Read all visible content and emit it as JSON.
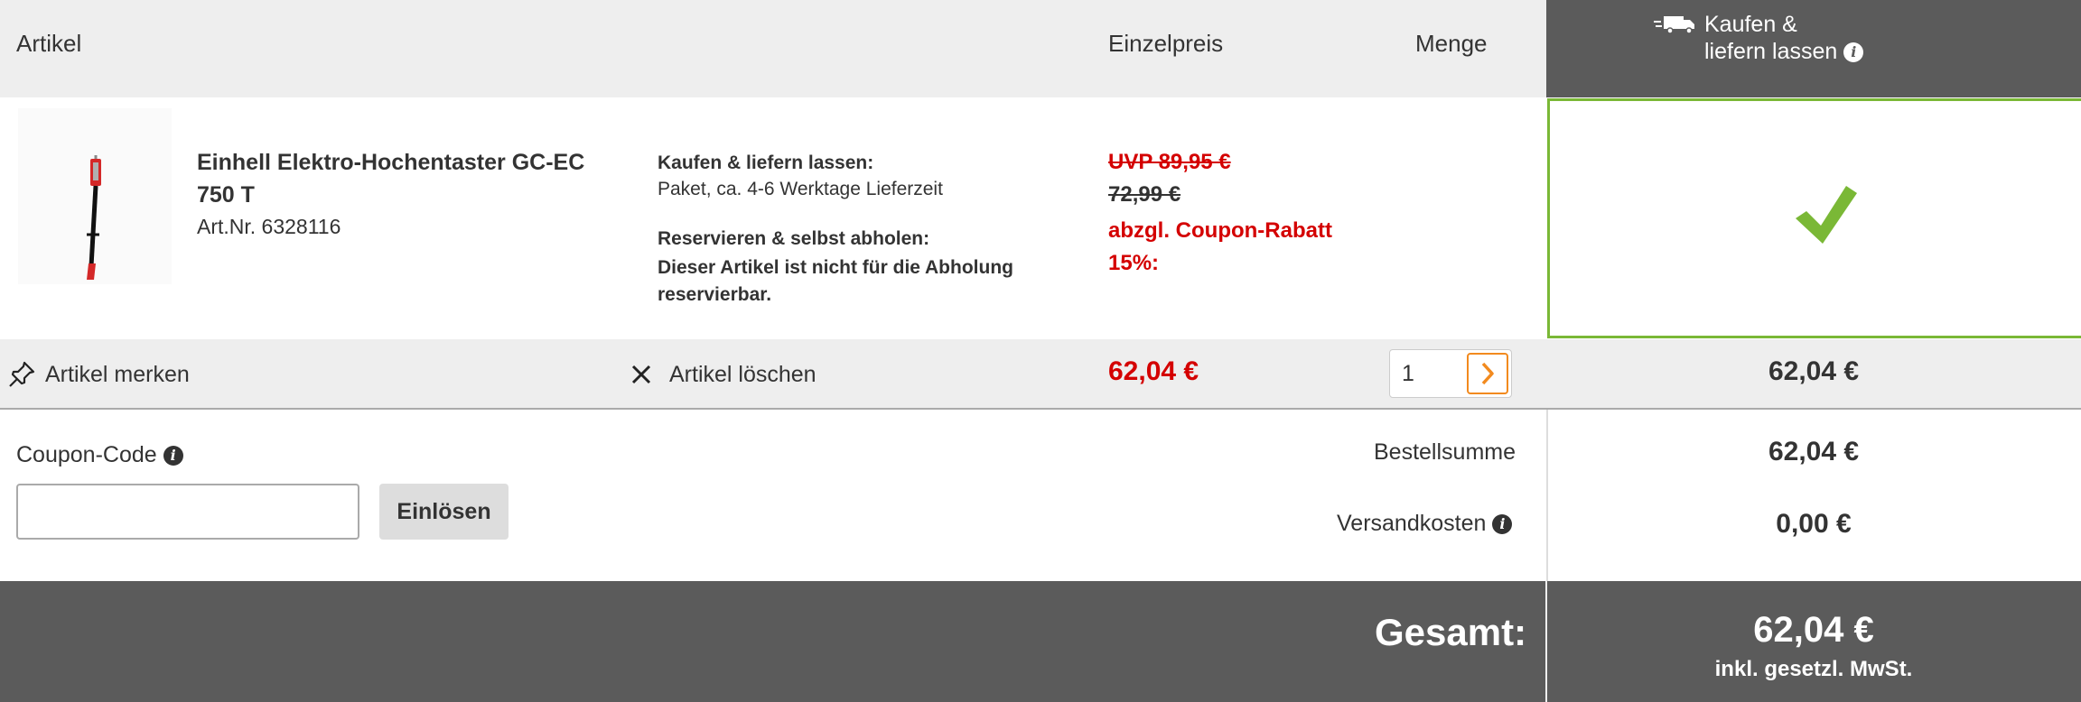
{
  "header": {
    "col_article": "Artikel",
    "col_unit_price": "Einzelpreis",
    "col_quantity": "Menge",
    "delivery_line1": "Kaufen &",
    "delivery_line2": "liefern lassen"
  },
  "product": {
    "name": "Einhell Elektro-Hochentaster GC-EC 750 T",
    "article_no": "Art.Nr. 6328116",
    "shipping_title": "Kaufen & liefern lassen:",
    "shipping_text": "Paket, ca. 4-6 Werktage Lieferzeit",
    "reserve_title": "Reservieren & selbst abholen:",
    "reserve_text": "Dieser Artikel ist nicht für die Abholung reservierbar.",
    "uvp": "UVP 89,95 €",
    "old_price": "72,99 €",
    "coupon_discount": "abzgl. Coupon-Rabatt 15%:",
    "price": "62,04 €",
    "quantity": "1",
    "row_total": "62,04 €"
  },
  "actions": {
    "remember": "Artikel merken",
    "delete": "Artikel löschen"
  },
  "coupon": {
    "label": "Coupon-Code",
    "input_value": "",
    "redeem_label": "Einlösen"
  },
  "summary": {
    "order_sum_label": "Bestellsumme",
    "order_sum_value": "62,04 €",
    "shipping_label": "Versandkosten",
    "shipping_value": "0,00 €",
    "total_label": "Gesamt:",
    "total_value": "62,04 €",
    "vat_note": "inkl. gesetzl. MwSt."
  },
  "icons": {
    "delivery": "delivery-truck-icon",
    "info": "info-icon",
    "pin": "pin-icon",
    "close": "close-icon",
    "chevron": "chevron-right-icon",
    "check": "checkmark-icon"
  },
  "colors": {
    "sale_red": "#d40000",
    "accent_green": "#7ab836",
    "accent_orange": "#f28a1e",
    "dark_bar": "#5b5b5b",
    "light_bg": "#eeeeee"
  }
}
